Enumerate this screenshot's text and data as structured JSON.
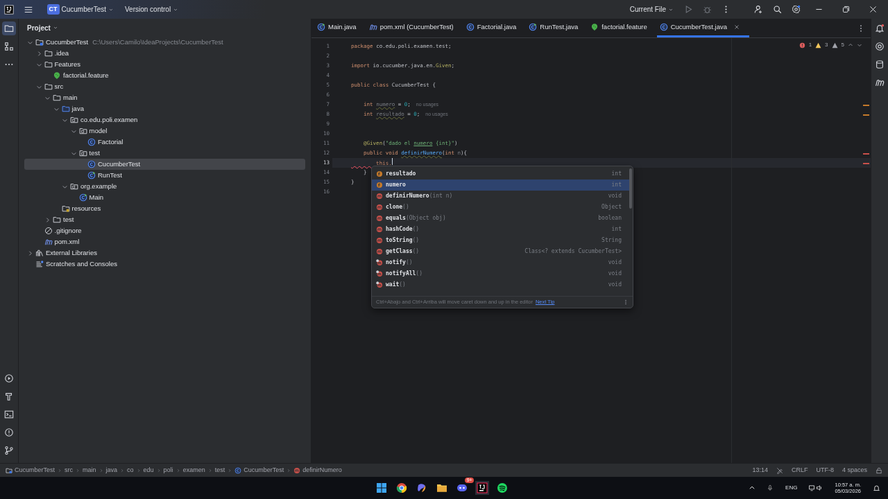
{
  "titlebar": {
    "project_badge": "CT",
    "project": "CucumberTest",
    "vcs": "Version control",
    "run_config": "Current File"
  },
  "project_panel": {
    "title": "Project",
    "tree": [
      {
        "label": "CucumberTest",
        "path": "C:\\Users\\Camilo\\IdeaProjects\\CucumberTest",
        "kind": "module",
        "expanded": true,
        "selected": false,
        "children": [
          {
            "label": ".idea",
            "kind": "folder",
            "expanded": false,
            "selected": false
          },
          {
            "label": "Features",
            "kind": "folder",
            "expanded": true,
            "selected": false,
            "children": [
              {
                "label": "factorial.feature",
                "kind": "feature",
                "selected": false
              }
            ]
          },
          {
            "label": "src",
            "kind": "folder",
            "expanded": true,
            "selected": false,
            "children": [
              {
                "label": "main",
                "kind": "folder",
                "expanded": true,
                "selected": false,
                "children": [
                  {
                    "label": "java",
                    "kind": "source_folder",
                    "expanded": true,
                    "selected": false,
                    "children": [
                      {
                        "label": "co.edu.poli.examen",
                        "kind": "package",
                        "expanded": true,
                        "selected": false,
                        "children": [
                          {
                            "label": "model",
                            "kind": "package",
                            "expanded": true,
                            "selected": false,
                            "children": [
                              {
                                "label": "Factorial",
                                "kind": "class",
                                "selected": false
                              }
                            ]
                          },
                          {
                            "label": "test",
                            "kind": "package",
                            "expanded": true,
                            "selected": false,
                            "children": [
                              {
                                "label": "CucumberTest",
                                "kind": "class",
                                "selected": true
                              },
                              {
                                "label": "RunTest",
                                "kind": "test_class",
                                "selected": false
                              }
                            ]
                          }
                        ]
                      },
                      {
                        "label": "org.example",
                        "kind": "package",
                        "expanded": true,
                        "selected": false,
                        "children": [
                          {
                            "label": "Main",
                            "kind": "main_class",
                            "selected": false
                          }
                        ]
                      }
                    ]
                  },
                  {
                    "label": "resources",
                    "kind": "resources",
                    "selected": false
                  }
                ]
              },
              {
                "label": "test",
                "kind": "folder",
                "expanded": false,
                "selected": false
              }
            ]
          },
          {
            "label": ".gitignore",
            "kind": "ignore",
            "selected": false
          },
          {
            "label": "pom.xml",
            "kind": "maven",
            "selected": false
          }
        ]
      },
      {
        "label": "External Libraries",
        "kind": "library",
        "expanded": false,
        "selected": false
      },
      {
        "label": "Scratches and Consoles",
        "kind": "scratches",
        "selected": false
      }
    ]
  },
  "tabs": [
    {
      "label": "Main.java",
      "kind": "main_class",
      "selected": false
    },
    {
      "label": "pom.xml (CucumberTest)",
      "kind": "maven",
      "selected": false
    },
    {
      "label": "Factorial.java",
      "kind": "class",
      "selected": false
    },
    {
      "label": "RunTest.java",
      "kind": "test_class",
      "selected": false
    },
    {
      "label": "factorial.feature",
      "kind": "feature",
      "selected": false
    },
    {
      "label": "CucumberTest.java",
      "kind": "class",
      "selected": true
    }
  ],
  "inspections": {
    "errors": "1",
    "warnings": "3",
    "weak_warnings": "5"
  },
  "code": [
    {
      "number": "1",
      "current": false,
      "segments": [
        {
          "kind": "keyword",
          "text": "package "
        },
        {
          "kind": "plain",
          "text": "co.edu.poli.examen.test;"
        }
      ]
    },
    {
      "number": "2",
      "current": false
    },
    {
      "number": "3",
      "current": false,
      "segments": [
        {
          "kind": "keyword",
          "text": "import "
        },
        {
          "kind": "plain",
          "text": "io.cucumber.java.en."
        },
        {
          "kind": "annotation",
          "text": "Given"
        },
        {
          "kind": "plain",
          "text": ";"
        }
      ]
    },
    {
      "number": "4",
      "current": false
    },
    {
      "number": "5",
      "current": false,
      "segments": [
        {
          "kind": "keyword",
          "text": "public class "
        },
        {
          "kind": "plain",
          "text": "CucumberTest {"
        }
      ]
    },
    {
      "number": "6",
      "current": false
    },
    {
      "number": "7",
      "current": false,
      "hint": "no usages",
      "segments": [
        {
          "kind": "keyword",
          "text": "    int "
        },
        {
          "kind": "unused",
          "text": "numero"
        },
        {
          "kind": "plain",
          "text": " = "
        },
        {
          "kind": "number",
          "text": "0"
        },
        {
          "kind": "plain",
          "text": ";"
        }
      ]
    },
    {
      "number": "8",
      "current": false,
      "hint": "no usages",
      "segments": [
        {
          "kind": "keyword",
          "text": "    int "
        },
        {
          "kind": "unused",
          "text": "resultado"
        },
        {
          "kind": "plain",
          "text": " = "
        },
        {
          "kind": "number",
          "text": "0"
        },
        {
          "kind": "plain",
          "text": ";"
        }
      ]
    },
    {
      "number": "9",
      "current": false
    },
    {
      "number": "10",
      "current": false
    },
    {
      "number": "11",
      "current": false,
      "segments": [
        {
          "kind": "annotation",
          "text": "    @Given"
        },
        {
          "kind": "plain",
          "text": "("
        },
        {
          "kind": "string",
          "text": "\"dado el "
        },
        {
          "kind": "string_ref",
          "text": "numero"
        },
        {
          "kind": "string",
          "text": " {int}\""
        },
        {
          "kind": "plain",
          "text": ")"
        }
      ]
    },
    {
      "number": "12",
      "current": false,
      "segments": [
        {
          "kind": "keyword",
          "text": "    public void "
        },
        {
          "kind": "method",
          "text": "definirNumero"
        },
        {
          "kind": "plain",
          "text": "("
        },
        {
          "kind": "keyword",
          "text": "int "
        },
        {
          "kind": "param",
          "text": "n"
        },
        {
          "kind": "plain",
          "text": "){"
        }
      ]
    },
    {
      "number": "13",
      "current": true,
      "segments": [
        {
          "kind": "error",
          "text": "        this."
        }
      ]
    },
    {
      "number": "14",
      "current": false,
      "segments": [
        {
          "kind": "plain",
          "text": "    }"
        }
      ]
    },
    {
      "number": "15",
      "current": false,
      "segments": [
        {
          "kind": "plain",
          "text": "}"
        }
      ]
    },
    {
      "number": "16",
      "current": false
    }
  ],
  "completion": {
    "items": [
      {
        "kind": "field",
        "name": "resultado",
        "type": "int",
        "selected": false
      },
      {
        "kind": "field",
        "name": "numero",
        "type": "int",
        "selected": true
      },
      {
        "kind": "method",
        "name": "definirNumero",
        "params": "(int n)",
        "type": "void",
        "selected": false
      },
      {
        "kind": "method",
        "name": "clone",
        "params": "()",
        "type": "Object",
        "selected": false
      },
      {
        "kind": "method",
        "name": "equals",
        "params": "(Object obj)",
        "type": "boolean",
        "selected": false
      },
      {
        "kind": "method",
        "name": "hashCode",
        "params": "()",
        "type": "int",
        "selected": false
      },
      {
        "kind": "method",
        "name": "toString",
        "params": "()",
        "type": "String",
        "selected": false
      },
      {
        "kind": "method",
        "name": "getClass",
        "params": "()",
        "type": "Class<? extends CucumberTest>",
        "selected": false
      },
      {
        "kind": "inherited",
        "name": "notify",
        "params": "()",
        "type": "void",
        "selected": false
      },
      {
        "kind": "inherited",
        "name": "notifyAll",
        "params": "()",
        "type": "void",
        "selected": false
      },
      {
        "kind": "inherited",
        "name": "wait",
        "params": "()",
        "type": "void",
        "selected": false
      }
    ],
    "tip": "Ctrl+Abajo and Ctrl+Arriba will move caret down and up in the editor",
    "tip_link": "Next Tip"
  },
  "status_bar": {
    "breadcrumbs": [
      {
        "label": "CucumberTest",
        "kind": "module"
      },
      {
        "label": "src",
        "kind": "none"
      },
      {
        "label": "main",
        "kind": "none"
      },
      {
        "label": "java",
        "kind": "none"
      },
      {
        "label": "co",
        "kind": "none"
      },
      {
        "label": "edu",
        "kind": "none"
      },
      {
        "label": "poli",
        "kind": "none"
      },
      {
        "label": "examen",
        "kind": "none"
      },
      {
        "label": "test",
        "kind": "none"
      },
      {
        "label": "CucumberTest",
        "kind": "class"
      },
      {
        "label": "definirNumero",
        "kind": "method"
      }
    ],
    "position": "13:14",
    "line_separator": "CRLF",
    "encoding": "UTF-8",
    "indent": "4 spaces"
  },
  "taskbar": {
    "discord_badge": "9+",
    "language": "ENG",
    "time": "10:57 a. m.",
    "date": "05/03/2026"
  }
}
